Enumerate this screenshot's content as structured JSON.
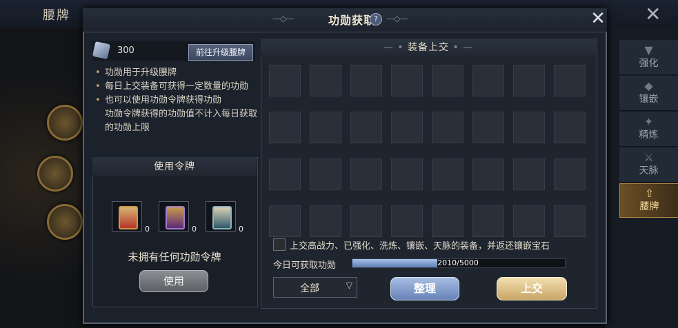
{
  "background": {
    "title": "腰牌",
    "side_tabs": [
      {
        "label": "强化",
        "icon": "anvil-icon",
        "active": false
      },
      {
        "label": "镶嵌",
        "icon": "gem-socket-icon",
        "active": false
      },
      {
        "label": "精炼",
        "icon": "refine-icon",
        "active": false
      },
      {
        "label": "天脉",
        "icon": "meridian-icon",
        "active": false
      },
      {
        "label": "腰牌",
        "icon": "badge-icon",
        "active": true
      }
    ]
  },
  "dialog": {
    "title": "功勋获取",
    "help_label": "?",
    "close_label": "✕"
  },
  "left": {
    "points": "300",
    "goto_button": "前往升级腰牌",
    "bullets": [
      "功勋用于升级腰牌",
      "每日上交装备可获得一定数量的功勋",
      "也可以使用功勋令牌获得功勋",
      "功勋令牌获得的功勋值不计入每日获取的功勋上限"
    ],
    "use_token_title": "使用令牌",
    "tokens": [
      {
        "count": "0",
        "color": "#b8342a"
      },
      {
        "count": "0",
        "color": "#5a2a7a"
      },
      {
        "count": "0",
        "color": "#2e5a6a"
      }
    ],
    "no_token_text": "未拥有任何功勋令牌",
    "use_button": "使用"
  },
  "right": {
    "title": "装备上交",
    "slot_rows": 4,
    "slot_cols": 8,
    "checkbox_label": "上交高战力、已强化、洗炼、镶嵌、天脉的装备，并返还镶嵌宝石",
    "checkbox_checked": false,
    "daily_label": "今日可获取功勋",
    "progress_text": "2010/5000",
    "progress_current": 2010,
    "progress_max": 5000,
    "filter_value": "全部",
    "sort_button": "整理",
    "submit_button": "上交"
  }
}
